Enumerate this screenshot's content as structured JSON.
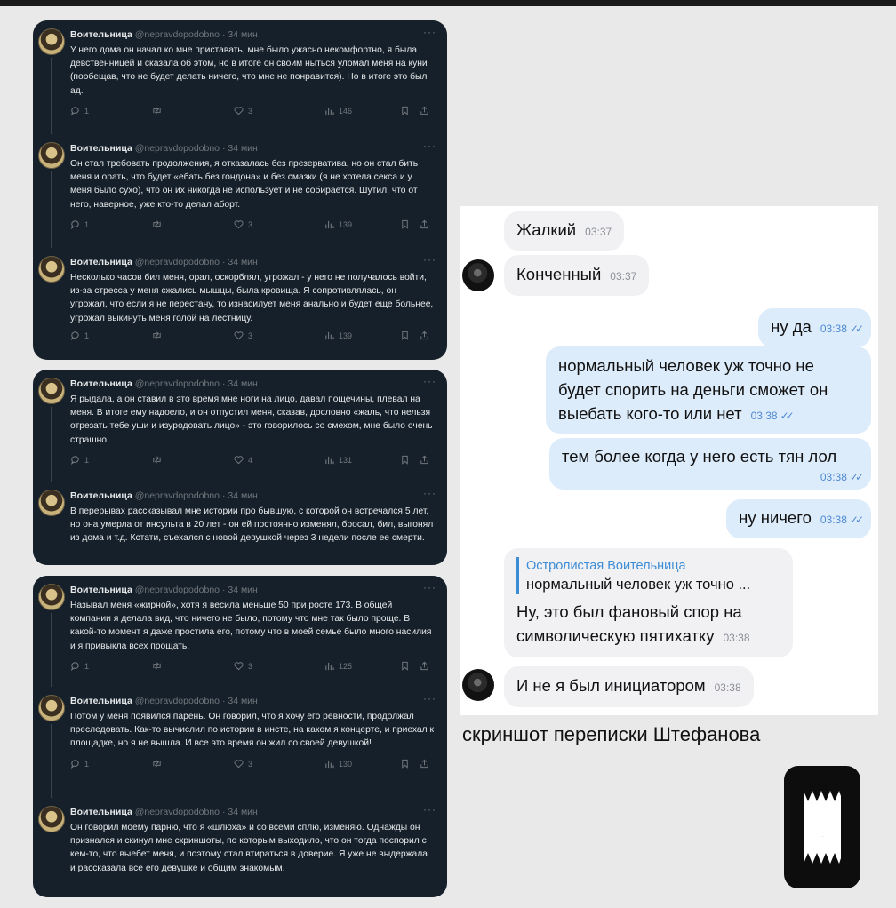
{
  "tweets_author": {
    "name": "Воительница",
    "handle": "@nepravdopodobno",
    "time": "· 34 мин",
    "more": "···"
  },
  "cards": [
    {
      "tweets": [
        {
          "text": "У него дома он начал ко мне приставать, мне было ужасно некомфортно, я была девственницей и сказала об этом, но в итоге он своим ныться уломал меня на куни (пообещав, что не будет делать ничего, что мне не понравится). Но в итоге это был ад.",
          "replies": "1",
          "retweets": "",
          "likes": "3",
          "views": "146"
        },
        {
          "text": "Он стал требовать продолжения, я отказалась без презерватива, но он стал бить меня и орать, что будет «ебать без гондона» и без смазки (я не хотела секса и у меня было сухо), что он их никогда не использует и не собирается. Шутил, что от него, наверное, уже кто-то делал аборт.",
          "replies": "1",
          "retweets": "",
          "likes": "3",
          "views": "139"
        },
        {
          "text": "Несколько часов бил меня, орал, оскорблял, угрожал - у него не получалось войти, из-за стресса у меня сжались мышцы, была кровища. Я сопротивлялась, он угрожал, что если я не перестану, то изнасилует меня анально и будет еще больнее, угрожал выкинуть меня голой на лестницу.",
          "replies": "1",
          "retweets": "",
          "likes": "3",
          "views": "139"
        }
      ]
    },
    {
      "tweets": [
        {
          "text": "Я рыдала, а он ставил в это время мне ноги на лицо, давал пощечины, плевал на меня. В итоге ему надоело, и он отпустил меня, сказав, дословно «жаль, что нельзя отрезать тебе уши и изуродовать лицо» - это говорилось со смехом, мне было очень страшно.",
          "replies": "1",
          "retweets": "",
          "likes": "4",
          "views": "131"
        },
        {
          "text": "В перерывах рассказывал мне истории про бывшую, с которой он встречался 5 лет, но она умерла от инсульта в 20 лет - он ей постоянно изменял, бросал, бил, выгонял из дома и т.д. Кстати, съехался с новой девушкой через 3 недели после ее смерти.",
          "replies": "",
          "retweets": "",
          "likes": "",
          "views": ""
        }
      ]
    },
    {
      "tweets": [
        {
          "text": "Называл меня «жирной», хотя я весила меньше 50 при росте 173. В общей компании я делала вид, что ничего не было, потому что мне так было проще. В какой-то момент я даже простила его, потому что в моей семье было много насилия и я привыкла всех прощать.",
          "replies": "1",
          "retweets": "",
          "likes": "3",
          "views": "125"
        },
        {
          "text": "Потом у меня появился парень. Он говорил, что я хочу его ревности, продолжал преследовать. Как-то вычислил по истории в инсте, на каком я концерте, и приехал к площадке, но я не вышла. И все это время он жил со своей девушкой!",
          "replies": "1",
          "retweets": "",
          "likes": "3",
          "views": "130"
        },
        {
          "text": "Он говорил моему парню, что я «шлюха» и со всеми сплю, изменяю. Однажды он признался и скинул мне скриншоты, по которым выходило, что он тогда поспорил с кем-то, что выебет меня, и поэтому стал втираться в доверие. Я уже не выдержала и рассказала все его девушке и общим знакомым.",
          "replies": "",
          "retweets": "",
          "likes": "",
          "views": ""
        }
      ]
    }
  ],
  "chat": {
    "messages": [
      {
        "dir": "in",
        "text": "Жалкий",
        "time": "03:37"
      },
      {
        "dir": "in",
        "text": "Конченный",
        "time": "03:37"
      },
      {
        "dir": "out",
        "text": "ну да",
        "time": "03:38"
      },
      {
        "dir": "out",
        "text": "нормальный человек уж точно не будет спорить на деньги сможет он выебать кого-то или нет",
        "time": "03:38"
      },
      {
        "dir": "out",
        "text": "тем более когда у него есть тян лол",
        "time": "03:38"
      },
      {
        "dir": "out",
        "text": "ну ничего",
        "time": "03:38"
      },
      {
        "dir": "in",
        "reply_name": "Остролистая Воительница",
        "reply_text": "нормальный человек уж точно ...",
        "text": "Ну, это был фановый спор на символическую пятихатку",
        "time": "03:38"
      },
      {
        "dir": "in",
        "text": "И не я был инициатором",
        "time": "03:38"
      }
    ]
  },
  "caption": "скриншот переписки Штефанова",
  "logo_letter": "O",
  "colors": {
    "tweet_bg": "#15202b",
    "incoming_bubble": "#f1f1f4",
    "outgoing_bubble": "#ddecfb",
    "accent": "#3d8dd6"
  }
}
